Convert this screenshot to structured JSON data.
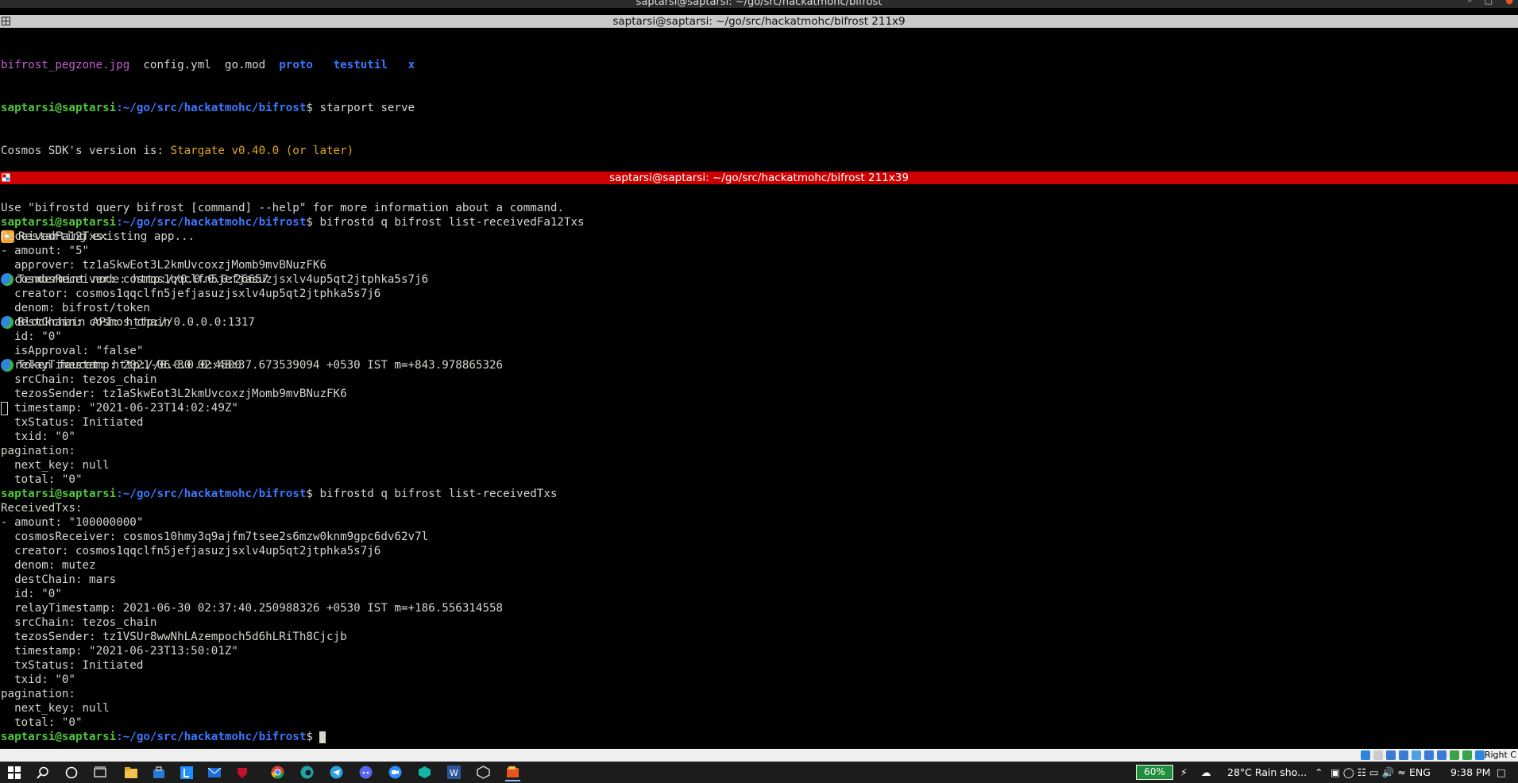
{
  "window": {
    "title": "saptarsi@saptarsi: ~/go/src/hackatmohc/bifrost"
  },
  "top_pane": {
    "title": "saptarsi@saptarsi: ~/go/src/hackatmohc/bifrost 211x9",
    "ls": {
      "f1": "bifrost_pegzone.jpg",
      "f2": "config.yml",
      "f3": "go.mod",
      "d1": "proto",
      "d2": "testutil",
      "d3": "x"
    },
    "prompt_user": "saptarsi@saptarsi",
    "prompt_path": ":~/go/src/hackatmohc/bifrost",
    "cmd1": "$ starport serve",
    "sdk_prefix": "Cosmos SDK's version is: ",
    "sdk_version": "Stargate v0.40.0 (or later)",
    "restart": "Restarting existing app...",
    "tendermint": "Tendermint node: http://0.0.0.0:26657",
    "api": "Blockchain API: http://0.0.0.0:1317",
    "faucet": "Token faucet: http://0.0.0.0:4500"
  },
  "bottom_pane": {
    "title": "saptarsi@saptarsi: ~/go/src/hackatmohc/bifrost 211x39",
    "lines": [
      {
        "t": "text",
        "v": ""
      },
      {
        "t": "text",
        "v": "Use \"bifrostd query bifrost [command] --help\" for more information about a command."
      },
      {
        "t": "prompt",
        "user": "saptarsi@saptarsi",
        "path": ":~/go/src/hackatmohc/bifrost",
        "cmd": "$ bifrostd q bifrost list-receivedFa12Txs"
      },
      {
        "t": "text",
        "v": "ReceivedFa12Txs:"
      },
      {
        "t": "text",
        "v": "- amount: \"5\""
      },
      {
        "t": "text",
        "v": "  approver: tz1aSkwEot3L2kmUvcoxzjMomb9mvBNuzFK6"
      },
      {
        "t": "text",
        "v": "  cosmosReceiver: cosmos1qqclfn5jefjasuzjsxlv4up5qt2jtphka5s7j6"
      },
      {
        "t": "text",
        "v": "  creator: cosmos1qqclfn5jefjasuzjsxlv4up5qt2jtphka5s7j6"
      },
      {
        "t": "text",
        "v": "  denom: bifrost/token"
      },
      {
        "t": "text",
        "v": "  destChain: cosmos_chain"
      },
      {
        "t": "text",
        "v": "  id: \"0\""
      },
      {
        "t": "text",
        "v": "  isApproval: \"false\""
      },
      {
        "t": "text",
        "v": "  relayTimestamp: 2021-06-30 02:48:37.673539094 +0530 IST m=+843.978865326"
      },
      {
        "t": "text",
        "v": "  srcChain: tezos_chain"
      },
      {
        "t": "text",
        "v": "  tezosSender: tz1aSkwEot3L2kmUvcoxzjMomb9mvBNuzFK6"
      },
      {
        "t": "text",
        "v": "  timestamp: \"2021-06-23T14:02:49Z\""
      },
      {
        "t": "text",
        "v": "  txStatus: Initiated"
      },
      {
        "t": "text",
        "v": "  txid: \"0\""
      },
      {
        "t": "text",
        "v": "pagination:"
      },
      {
        "t": "text",
        "v": "  next_key: null"
      },
      {
        "t": "text",
        "v": "  total: \"0\""
      },
      {
        "t": "prompt",
        "user": "saptarsi@saptarsi",
        "path": ":~/go/src/hackatmohc/bifrost",
        "cmd": "$ bifrostd q bifrost list-receivedTxs"
      },
      {
        "t": "text",
        "v": "ReceivedTxs:"
      },
      {
        "t": "text",
        "v": "- amount: \"100000000\""
      },
      {
        "t": "text",
        "v": "  cosmosReceiver: cosmos10hmy3q9ajfm7tsee2s6mzw0knm9gpc6dv62v7l"
      },
      {
        "t": "text",
        "v": "  creator: cosmos1qqclfn5jefjasuzjsxlv4up5qt2jtphka5s7j6"
      },
      {
        "t": "text",
        "v": "  denom: mutez"
      },
      {
        "t": "text",
        "v": "  destChain: mars"
      },
      {
        "t": "text",
        "v": "  id: \"0\""
      },
      {
        "t": "text",
        "v": "  relayTimestamp: 2021-06-30 02:37:40.250988326 +0530 IST m=+186.556314558"
      },
      {
        "t": "text",
        "v": "  srcChain: tezos_chain"
      },
      {
        "t": "text",
        "v": "  tezosSender: tz1VSUr8wwNhLAzempoch5d6hLRiTh8Cjcjb"
      },
      {
        "t": "text",
        "v": "  timestamp: \"2021-06-23T13:50:01Z\""
      },
      {
        "t": "text",
        "v": "  txStatus: Initiated"
      },
      {
        "t": "text",
        "v": "  txid: \"0\""
      },
      {
        "t": "text",
        "v": "pagination:"
      },
      {
        "t": "text",
        "v": "  next_key: null"
      },
      {
        "t": "text",
        "v": "  total: \"0\""
      },
      {
        "t": "prompt",
        "user": "saptarsi@saptarsi",
        "path": ":~/go/src/hackatmohc/bifrost",
        "cmd": "$ ",
        "cursor": true
      }
    ]
  },
  "tray_row": {
    "label": "Right C"
  },
  "taskbar": {
    "battery": "60%",
    "weather": "28°C  Rain sho...",
    "lang": "ENG",
    "time": "9:38 PM"
  },
  "colors": {
    "prompt_user": "#4ec83a",
    "prompt_path": "#3b78ff",
    "active_bar": "#cc0000",
    "highlight": "#e0a61a"
  }
}
